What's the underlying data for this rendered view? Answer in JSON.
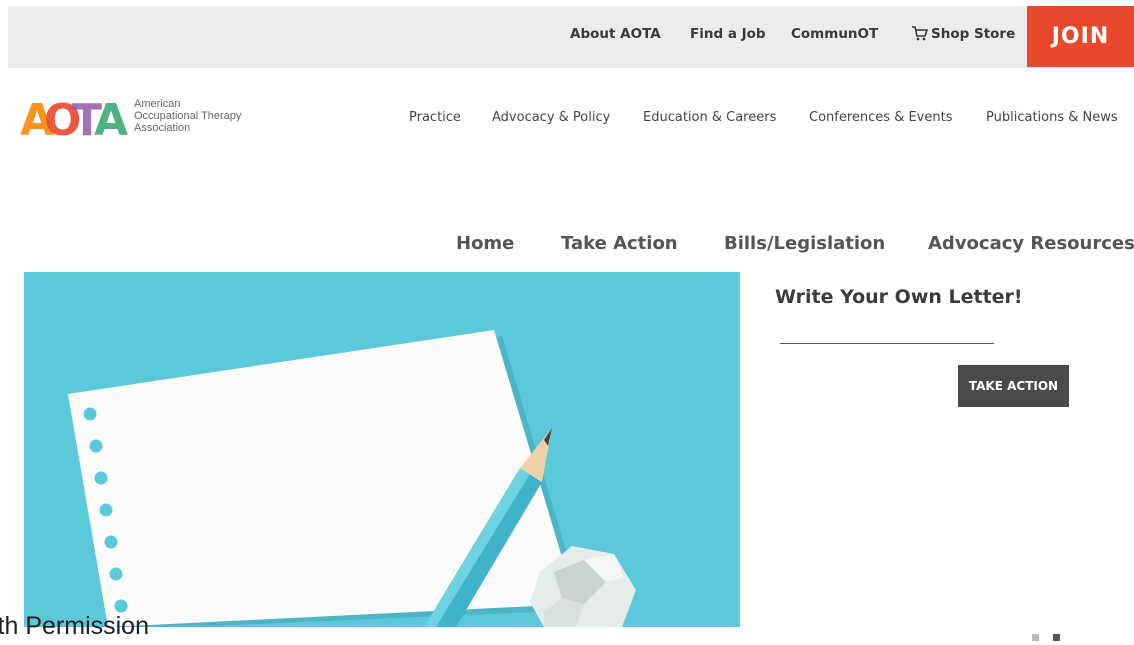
{
  "utility_nav": {
    "about": "About AOTA",
    "find_job": "Find a Job",
    "communot": "CommunOT",
    "shop": "Shop Store",
    "join": "JOIN"
  },
  "logo": {
    "mark": "AOTA",
    "line1": "American",
    "line2": "Occupational Therapy",
    "line3": "Association"
  },
  "main_nav": [
    "Practice",
    "Advocacy & Policy",
    "Education & Careers",
    "Conferences & Events",
    "Publications & News"
  ],
  "sub_nav": [
    "Home",
    "Take Action",
    "Bills/Legislation",
    "Advocacy Resources"
  ],
  "hero": {
    "title": "Write Your Own Letter!",
    "button": "TAKE ACTION"
  },
  "caption": "ith Permission",
  "carousel": {
    "dot_count": 2
  },
  "colors": {
    "join": "#e8482b",
    "hero_bg": "#5cc9da",
    "button": "#4a4a4a",
    "logo_orange": "#f7941d",
    "logo_red": "#e8482b",
    "logo_purple": "#8e5aa6",
    "logo_green": "#2ea66e"
  }
}
